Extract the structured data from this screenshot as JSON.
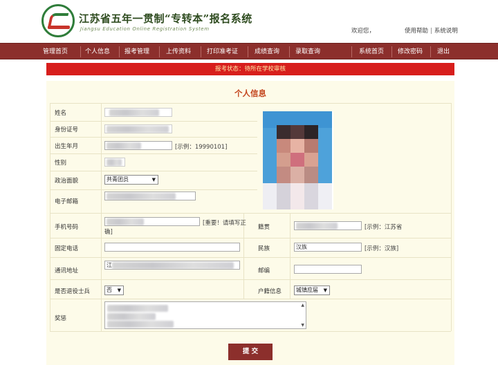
{
  "header": {
    "site_title": "江苏省五年一贯制“专转本”报名系统",
    "site_subtitle": "Jiangsu Education Online Registration System",
    "welcome": "欢迎您，",
    "help_link": "使用帮助",
    "separator": "|",
    "manual_link": "系统说明"
  },
  "nav": {
    "items": [
      "管理首页",
      "个人信息",
      "报考管理",
      "上传资料",
      "打印准考证",
      "成绩查询",
      "录取查询"
    ],
    "right_items": [
      "系统首页",
      "修改密码",
      "退出"
    ]
  },
  "status_bar": "报考状态：待所在学校审核",
  "form": {
    "title": "个人信息",
    "labels": {
      "name": "姓名",
      "id_number": "身份证号",
      "birth": "出生年月",
      "gender": "性别",
      "political": "政治面貌",
      "email": "电子邮箱",
      "mobile": "手机号码",
      "native_place": "籍贯",
      "landline": "固定电话",
      "ethnicity": "民族",
      "address": "通讯地址",
      "postcode": "邮编",
      "veteran": "是否退役士兵",
      "hukou": "户籍信息",
      "awards": "奖惩"
    },
    "hints": {
      "birth": "[示例：19990101]",
      "mobile_line1": "[重要！请填写正",
      "mobile_line2": "确]",
      "native_place": "[示例：江苏省",
      "ethnicity": "[示例：汉族]"
    },
    "values": {
      "political": "共青团员",
      "ethnicity": "汉族",
      "veteran": "否",
      "hukou": "城镇应届",
      "native_place_prefix": "",
      "address_prefix": "江"
    },
    "submit_label": "提 交"
  }
}
